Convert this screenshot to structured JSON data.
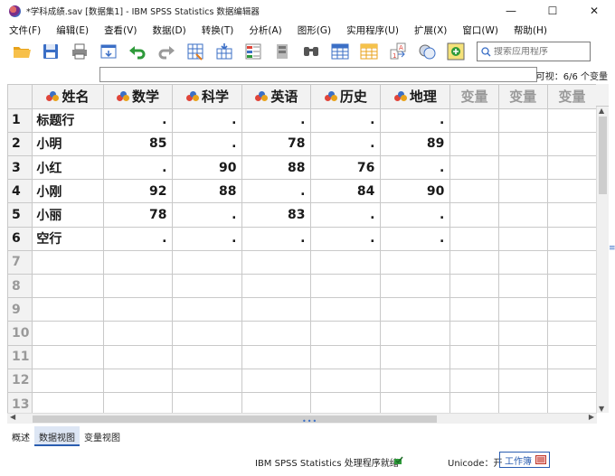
{
  "window": {
    "title": "*学科成绩.sav [数据集1] - IBM SPSS Statistics 数据编辑器",
    "minimize_glyph": "—",
    "maximize_glyph": "☐",
    "close_glyph": "✕"
  },
  "menu": [
    "文件(F)",
    "编辑(E)",
    "查看(V)",
    "数据(D)",
    "转换(T)",
    "分析(A)",
    "图形(G)",
    "实用程序(U)",
    "扩展(X)",
    "窗口(W)",
    "帮助(H)"
  ],
  "toolbar": {
    "icons": [
      "open-folder-icon",
      "save-icon",
      "print-icon",
      "dialog-recall-icon",
      "undo-icon",
      "redo-icon",
      "goto-case-icon",
      "goto-variable-icon",
      "variables-icon",
      "run-descriptives-icon",
      "find-icon",
      "split-file-icon",
      "weight-cases-icon",
      "value-labels-icon",
      "use-sets-icon",
      "customize-icon"
    ],
    "search_placeholder": "搜索应用程序"
  },
  "cell_editor": {
    "value": "",
    "visible_count": "可视：6/6 个变量"
  },
  "grid": {
    "columns": [
      {
        "label": "姓名",
        "type": "string"
      },
      {
        "label": "数学",
        "type": "numeric"
      },
      {
        "label": "科学",
        "type": "numeric"
      },
      {
        "label": "英语",
        "type": "numeric"
      },
      {
        "label": "历史",
        "type": "numeric"
      },
      {
        "label": "地理",
        "type": "numeric"
      },
      {
        "label": "变量",
        "type": "empty"
      },
      {
        "label": "变量",
        "type": "empty"
      },
      {
        "label": "变量",
        "type": "empty"
      }
    ],
    "rows": [
      {
        "num": "1",
        "cells": [
          "标题行",
          ".",
          ".",
          ".",
          ".",
          ".",
          "",
          "",
          ""
        ]
      },
      {
        "num": "2",
        "cells": [
          "小明",
          "85",
          ".",
          "78",
          ".",
          "89",
          "",
          "",
          ""
        ]
      },
      {
        "num": "3",
        "cells": [
          "小红",
          ".",
          "90",
          "88",
          "76",
          ".",
          "",
          "",
          ""
        ]
      },
      {
        "num": "4",
        "cells": [
          "小刚",
          "92",
          "88",
          ".",
          "84",
          "90",
          "",
          "",
          ""
        ]
      },
      {
        "num": "5",
        "cells": [
          "小丽",
          "78",
          ".",
          "83",
          ".",
          ".",
          "",
          "",
          ""
        ]
      },
      {
        "num": "6",
        "cells": [
          "空行",
          ".",
          ".",
          ".",
          ".",
          ".",
          "",
          "",
          ""
        ]
      },
      {
        "num": "7",
        "cells": [
          "",
          "",
          "",
          "",
          "",
          "",
          "",
          "",
          ""
        ]
      },
      {
        "num": "8",
        "cells": [
          "",
          "",
          "",
          "",
          "",
          "",
          "",
          "",
          ""
        ]
      },
      {
        "num": "9",
        "cells": [
          "",
          "",
          "",
          "",
          "",
          "",
          "",
          "",
          ""
        ]
      },
      {
        "num": "10",
        "cells": [
          "",
          "",
          "",
          "",
          "",
          "",
          "",
          "",
          ""
        ]
      },
      {
        "num": "11",
        "cells": [
          "",
          "",
          "",
          "",
          "",
          "",
          "",
          "",
          ""
        ]
      },
      {
        "num": "12",
        "cells": [
          "",
          "",
          "",
          "",
          "",
          "",
          "",
          "",
          ""
        ]
      },
      {
        "num": "13",
        "cells": [
          "",
          "",
          "",
          "",
          "",
          "",
          "",
          "",
          ""
        ]
      }
    ]
  },
  "tabs": [
    {
      "label": "概述",
      "active": false
    },
    {
      "label": "数据视图",
      "active": true
    },
    {
      "label": "变量视图",
      "active": false
    }
  ],
  "status": {
    "processor": "IBM SPSS Statistics 处理程序就绪",
    "unicode": "Unicode：开",
    "workbook": "工作簿"
  },
  "colors": {
    "accent": "#2a5db0",
    "header_bg": "#f2f2f2",
    "grid_line": "#c9c9c9"
  }
}
